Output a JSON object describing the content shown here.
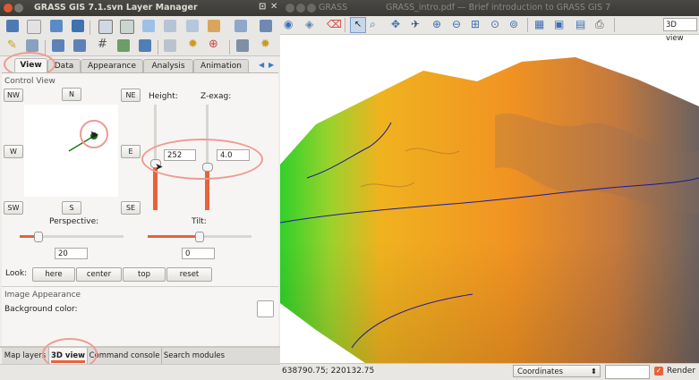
{
  "layer_manager": {
    "title": "GRASS GIS 7.1.svn Layer Manager",
    "tabs": [
      "View",
      "Data",
      "Appearance",
      "Analysis",
      "Animation"
    ],
    "section_control_view": "Control View",
    "directions": {
      "nw": "NW",
      "n": "N",
      "ne": "NE",
      "w": "W",
      "e": "E",
      "sw": "SW",
      "s": "S",
      "se": "SE"
    },
    "height_label": "Height:",
    "height_value": "252",
    "zexag_label": "Z-exag:",
    "zexag_value": "4.0",
    "perspective_label": "Perspective:",
    "perspective_value": "20",
    "tilt_label": "Tilt:",
    "tilt_value": "0",
    "look_label": "Look:",
    "look_buttons": [
      "here",
      "center",
      "top",
      "reset"
    ],
    "section_image_appearance": "Image Appearance",
    "background_color_label": "Background color:",
    "bottom_tabs": [
      "Map layers",
      "3D view",
      "Command console",
      "Search modules"
    ]
  },
  "map_window": {
    "title_parts": [
      "GRASS",
      "GRASS_intro.pdf — Brief introduction to GRASS GIS 7"
    ],
    "view_mode": "3D view",
    "coordinates_text": "638790.75; 220132.75",
    "coordinates_mode": "Coordinates",
    "render_label": "Render"
  },
  "colors": {
    "accent_circle": "#ef9a93",
    "active_tab_marker": "#e8623b"
  }
}
